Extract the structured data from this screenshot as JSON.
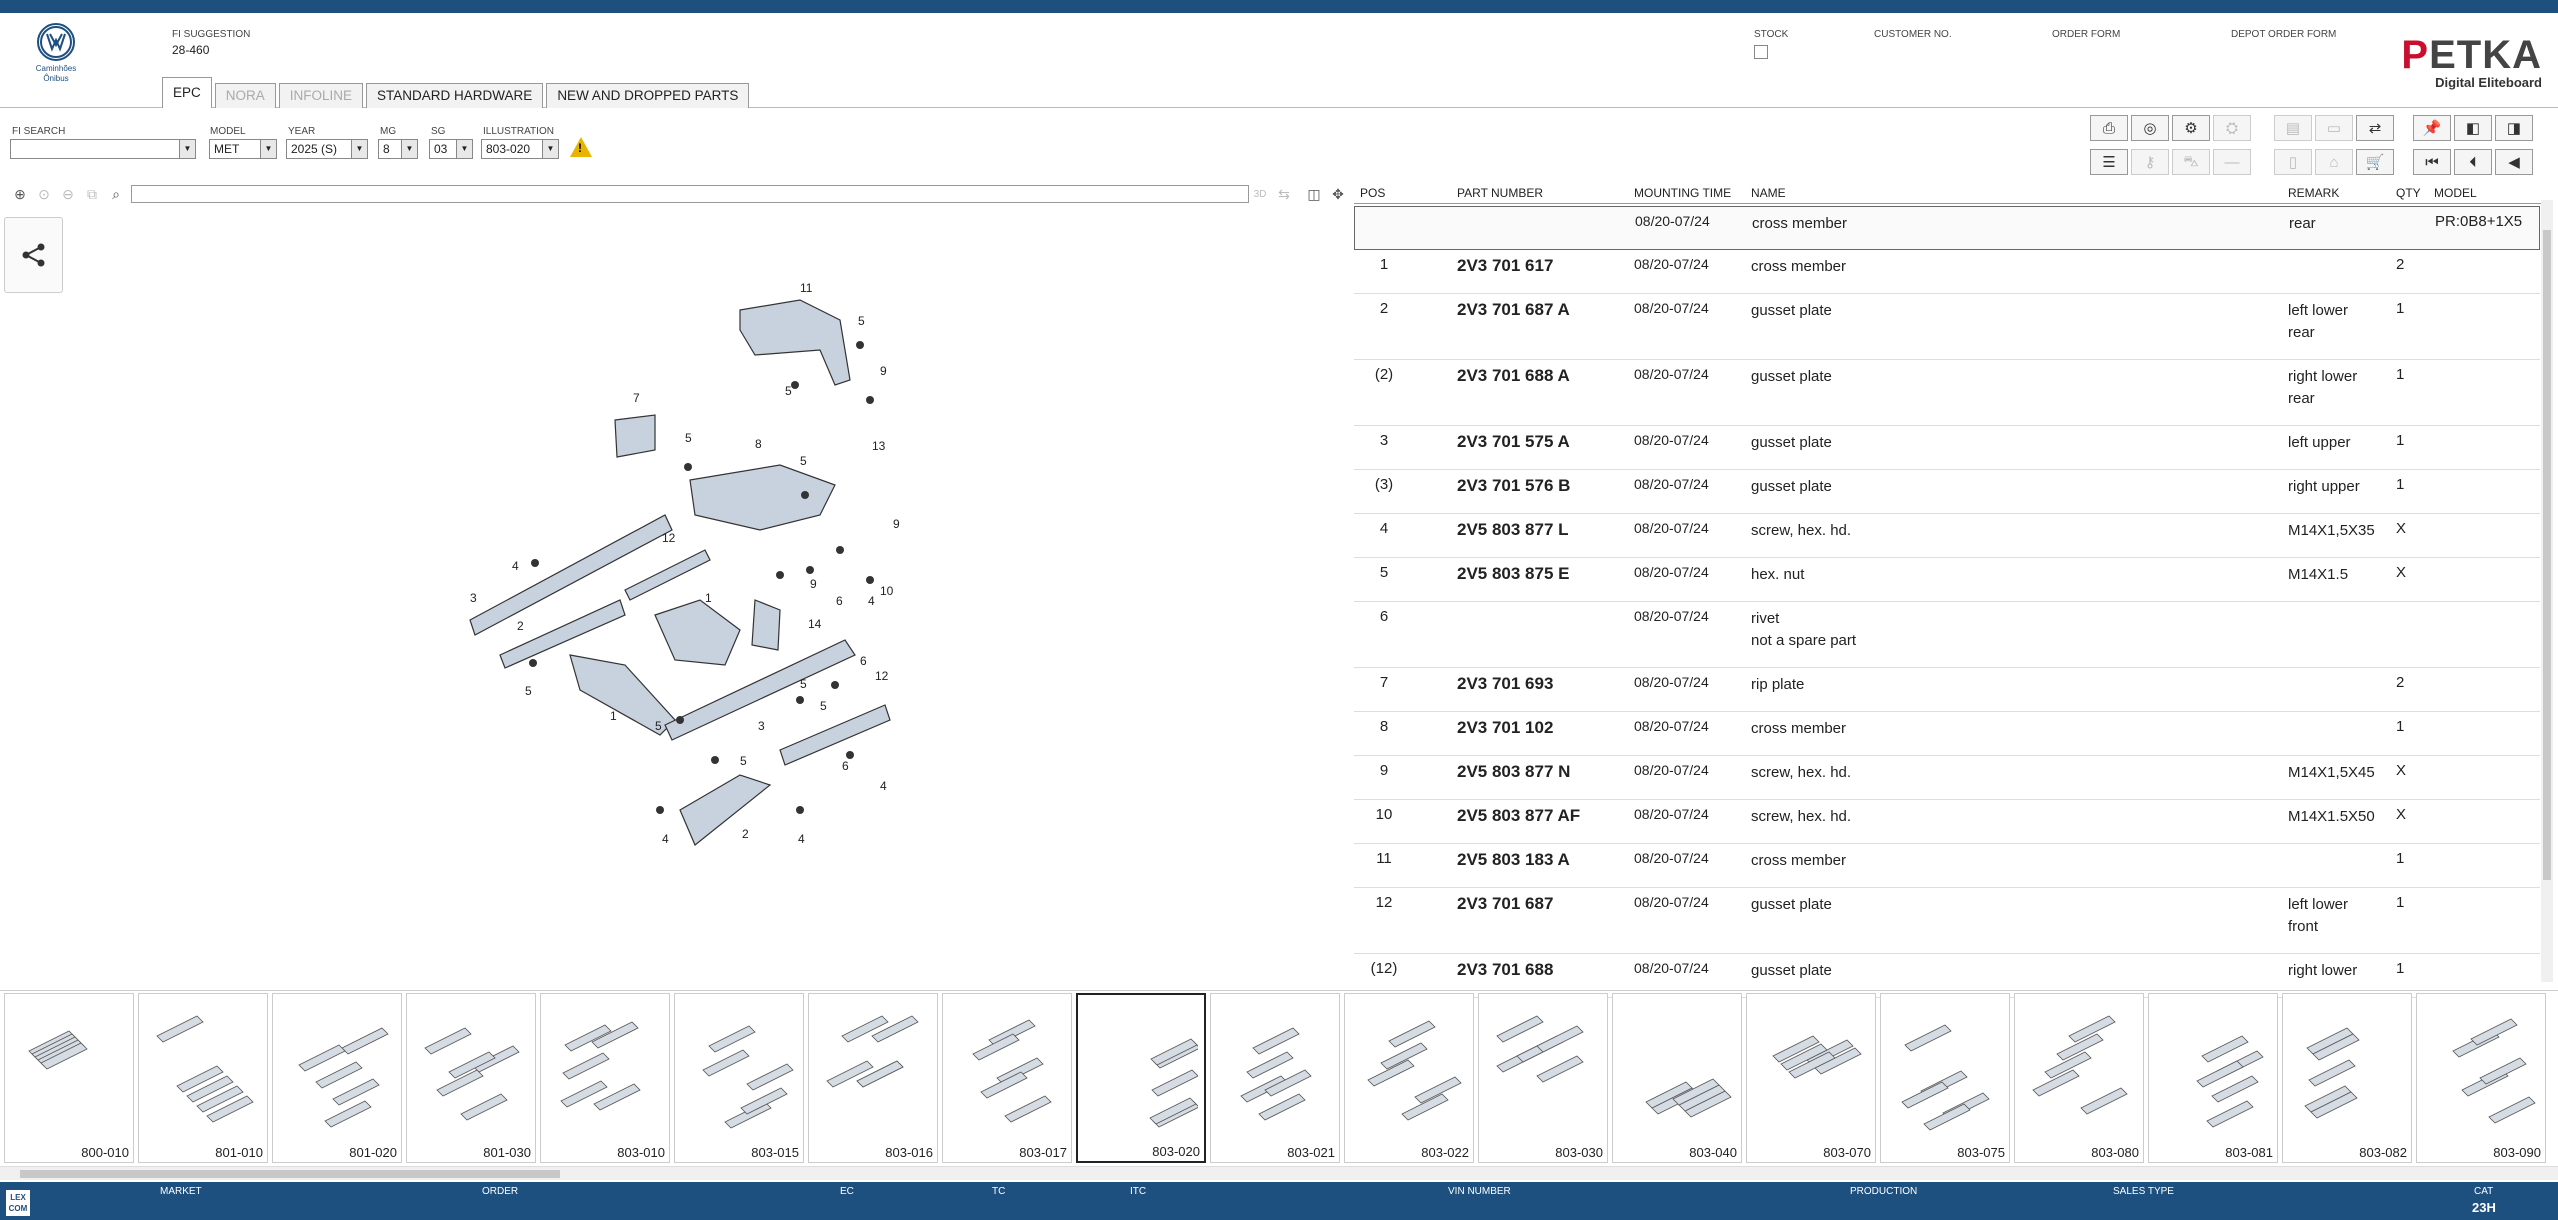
{
  "header": {
    "brand_sub": "Caminhões Ônibus",
    "fi_suggestion_label": "FI SUGGESTION",
    "fi_suggestion_value": "28-460",
    "stock_label": "STOCK",
    "customer_label": "CUSTOMER NO.",
    "order_form_label": "ORDER FORM",
    "depot_label": "DEPOT ORDER FORM",
    "logo_p": "P",
    "logo_rest": "ETKA",
    "logo_sub": "Digital Eliteboard",
    "tabs": [
      "EPC",
      "NORA",
      "INFOLINE",
      "STANDARD HARDWARE",
      "NEW AND DROPPED PARTS"
    ]
  },
  "filters": {
    "fi_search_label": "FI SEARCH",
    "fi_search_value": "",
    "model_label": "MODEL",
    "model_value": "MET",
    "year_label": "YEAR",
    "year_value": "2025 (S)",
    "mg_label": "MG",
    "mg_value": "8",
    "sg_label": "SG",
    "sg_value": "03",
    "illustration_label": "ILLUSTRATION",
    "illustration_value": "803-020",
    "warning_glyph": "!"
  },
  "viewer": {
    "btn_3d": "3D"
  },
  "table": {
    "headers": [
      "POS",
      "PART NUMBER",
      "MOUNTING TIME",
      "NAME",
      "REMARK",
      "QTY",
      "MODEL"
    ],
    "rows": [
      {
        "pos": "",
        "pn": "",
        "mt": "08/20-07/24",
        "name": "cross member",
        "name2": "",
        "remark": "rear",
        "remark2": "",
        "qty": "",
        "model": "PR:0B8+1X5"
      },
      {
        "pos": "1",
        "pn": "2V3 701 617",
        "mt": "08/20-07/24",
        "name": "cross member",
        "name2": "",
        "remark": "",
        "remark2": "",
        "qty": "2",
        "model": ""
      },
      {
        "pos": "2",
        "pn": "2V3 701 687 A",
        "mt": "08/20-07/24",
        "name": "gusset plate",
        "name2": "",
        "remark": "left lower",
        "remark2": "rear",
        "qty": "1",
        "model": ""
      },
      {
        "pos": "(2)",
        "pn": "2V3 701 688 A",
        "mt": "08/20-07/24",
        "name": "gusset plate",
        "name2": "",
        "remark": "right lower",
        "remark2": "rear",
        "qty": "1",
        "model": ""
      },
      {
        "pos": "3",
        "pn": "2V3 701 575 A",
        "mt": "08/20-07/24",
        "name": "gusset plate",
        "name2": "",
        "remark": "left upper",
        "remark2": "",
        "qty": "1",
        "model": ""
      },
      {
        "pos": "(3)",
        "pn": "2V3 701 576 B",
        "mt": "08/20-07/24",
        "name": "gusset plate",
        "name2": "",
        "remark": "right upper",
        "remark2": "",
        "qty": "1",
        "model": ""
      },
      {
        "pos": "4",
        "pn": "2V5 803 877 L",
        "mt": "08/20-07/24",
        "name": "screw, hex. hd.",
        "name2": "",
        "remark": "M14X1,5X35",
        "remark2": "",
        "qty": "X",
        "model": ""
      },
      {
        "pos": "5",
        "pn": "2V5 803 875 E",
        "mt": "08/20-07/24",
        "name": "hex. nut",
        "name2": "",
        "remark": "M14X1.5",
        "remark2": "",
        "qty": "X",
        "model": ""
      },
      {
        "pos": "6",
        "pn": "",
        "mt": "08/20-07/24",
        "name": "rivet",
        "name2": "not a spare part",
        "remark": "",
        "remark2": "",
        "qty": "",
        "model": ""
      },
      {
        "pos": "7",
        "pn": "2V3 701 693",
        "mt": "08/20-07/24",
        "name": "rip plate",
        "name2": "",
        "remark": "",
        "remark2": "",
        "qty": "2",
        "model": ""
      },
      {
        "pos": "8",
        "pn": "2V3 701 102",
        "mt": "08/20-07/24",
        "name": "cross member",
        "name2": "",
        "remark": "",
        "remark2": "",
        "qty": "1",
        "model": ""
      },
      {
        "pos": "9",
        "pn": "2V5 803 877 N",
        "mt": "08/20-07/24",
        "name": "screw, hex. hd.",
        "name2": "",
        "remark": "M14X1,5X45",
        "remark2": "",
        "qty": "X",
        "model": ""
      },
      {
        "pos": "10",
        "pn": "2V5 803 877 AF",
        "mt": "08/20-07/24",
        "name": "screw, hex. hd.",
        "name2": "",
        "remark": "M14X1.5X50",
        "remark2": "",
        "qty": "X",
        "model": ""
      },
      {
        "pos": "11",
        "pn": "2V5 803 183 A",
        "mt": "08/20-07/24",
        "name": "cross member",
        "name2": "",
        "remark": "",
        "remark2": "",
        "qty": "1",
        "model": ""
      },
      {
        "pos": "12",
        "pn": "2V3 701 687",
        "mt": "08/20-07/24",
        "name": "gusset plate",
        "name2": "",
        "remark": "left lower",
        "remark2": "front",
        "qty": "1",
        "model": ""
      },
      {
        "pos": "(12)",
        "pn": "2V3 701 688",
        "mt": "08/20-07/24",
        "name": "gusset plate",
        "name2": "",
        "remark": "right lower",
        "remark2": "",
        "qty": "1",
        "model": ""
      }
    ]
  },
  "drawing_labels": [
    "11",
    "5",
    "9",
    "5",
    "13",
    "7",
    "5",
    "8",
    "5",
    "9",
    "4",
    "12",
    "3",
    "1",
    "9",
    "6",
    "4",
    "10",
    "2",
    "14",
    "5",
    "6",
    "12",
    "5",
    "3",
    "5",
    "1",
    "5",
    "5",
    "6",
    "4",
    "4",
    "2",
    "4"
  ],
  "thumbnails": [
    "800-010",
    "801-010",
    "801-020",
    "801-030",
    "803-010",
    "803-015",
    "803-016",
    "803-017",
    "803-020",
    "803-021",
    "803-022",
    "803-030",
    "803-040",
    "803-070",
    "803-075",
    "803-080",
    "803-081",
    "803-082",
    "803-090"
  ],
  "selected_thumbnail": "803-020",
  "footer": {
    "lexcom": "LEX COM",
    "market": "MARKET",
    "order": "ORDER",
    "ec": "EC",
    "tc": "TC",
    "itc": "ITC",
    "vin": "VIN NUMBER",
    "production": "PRODUCTION",
    "sales_type": "SALES TYPE",
    "cat_label": "CAT",
    "cat_value": "23H"
  },
  "colors": {
    "brand": "#1d4f7f",
    "petka_red": "#c8102e",
    "warning": "#e8b400"
  }
}
